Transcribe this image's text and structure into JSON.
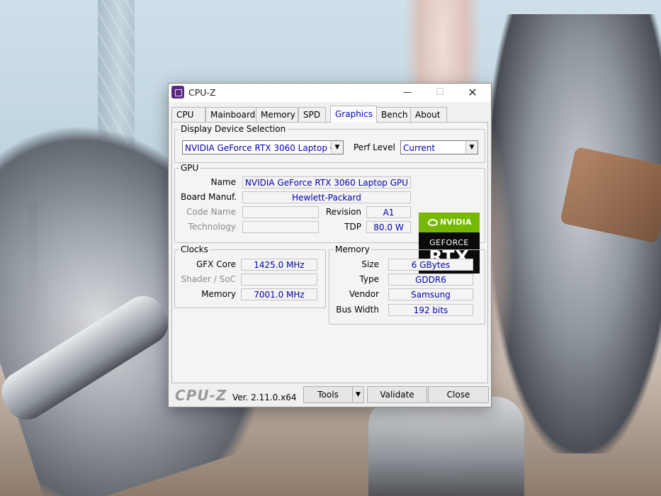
{
  "window": {
    "title": "CPU-Z",
    "minimize": "—",
    "maximize": "☐",
    "close": "✕"
  },
  "tabs": [
    {
      "label": "CPU"
    },
    {
      "label": "Mainboard"
    },
    {
      "label": "Memory"
    },
    {
      "label": "SPD"
    },
    {
      "label": "Graphics",
      "active": true
    },
    {
      "label": "Bench"
    },
    {
      "label": "About"
    }
  ],
  "display_device": {
    "group_title": "Display Device Selection",
    "selected_device": "NVIDIA GeForce RTX 3060 Laptop GPU",
    "perf_level_label": "Perf Level",
    "perf_level_value": "Current"
  },
  "gpu": {
    "group_title": "GPU",
    "name_label": "Name",
    "name_value": "NVIDIA GeForce RTX 3060 Laptop GPU",
    "board_manuf_label": "Board Manuf.",
    "board_manuf_value": "Hewlett-Packard",
    "code_name_label": "Code Name",
    "code_name_value": "",
    "revision_label": "Revision",
    "revision_value": "A1",
    "technology_label": "Technology",
    "technology_value": "",
    "tdp_label": "TDP",
    "tdp_value": "80.0 W",
    "logo": {
      "brand": "NVIDIA",
      "line1": "GEFORCE",
      "line2": "RTX",
      "brand_color": "#76b900"
    }
  },
  "clocks": {
    "group_title": "Clocks",
    "gfx_core_label": "GFX Core",
    "gfx_core_value": "1425.0 MHz",
    "shader_label": "Shader / SoC",
    "shader_value": "",
    "memory_label": "Memory",
    "memory_value": "7001.0 MHz"
  },
  "memory": {
    "group_title": "Memory",
    "size_label": "Size",
    "size_value": "6 GBytes",
    "type_label": "Type",
    "type_value": "GDDR6",
    "vendor_label": "Vendor",
    "vendor_value": "Samsung",
    "bus_width_label": "Bus Width",
    "bus_width_value": "192 bits"
  },
  "footer": {
    "brand": "CPU-Z",
    "version": "Ver. 2.11.0.x64",
    "tools_label": "Tools",
    "validate_label": "Validate",
    "close_label": "Close"
  },
  "colors": {
    "value_text": "#0000aa",
    "active_tab_text": "#0000cc"
  }
}
